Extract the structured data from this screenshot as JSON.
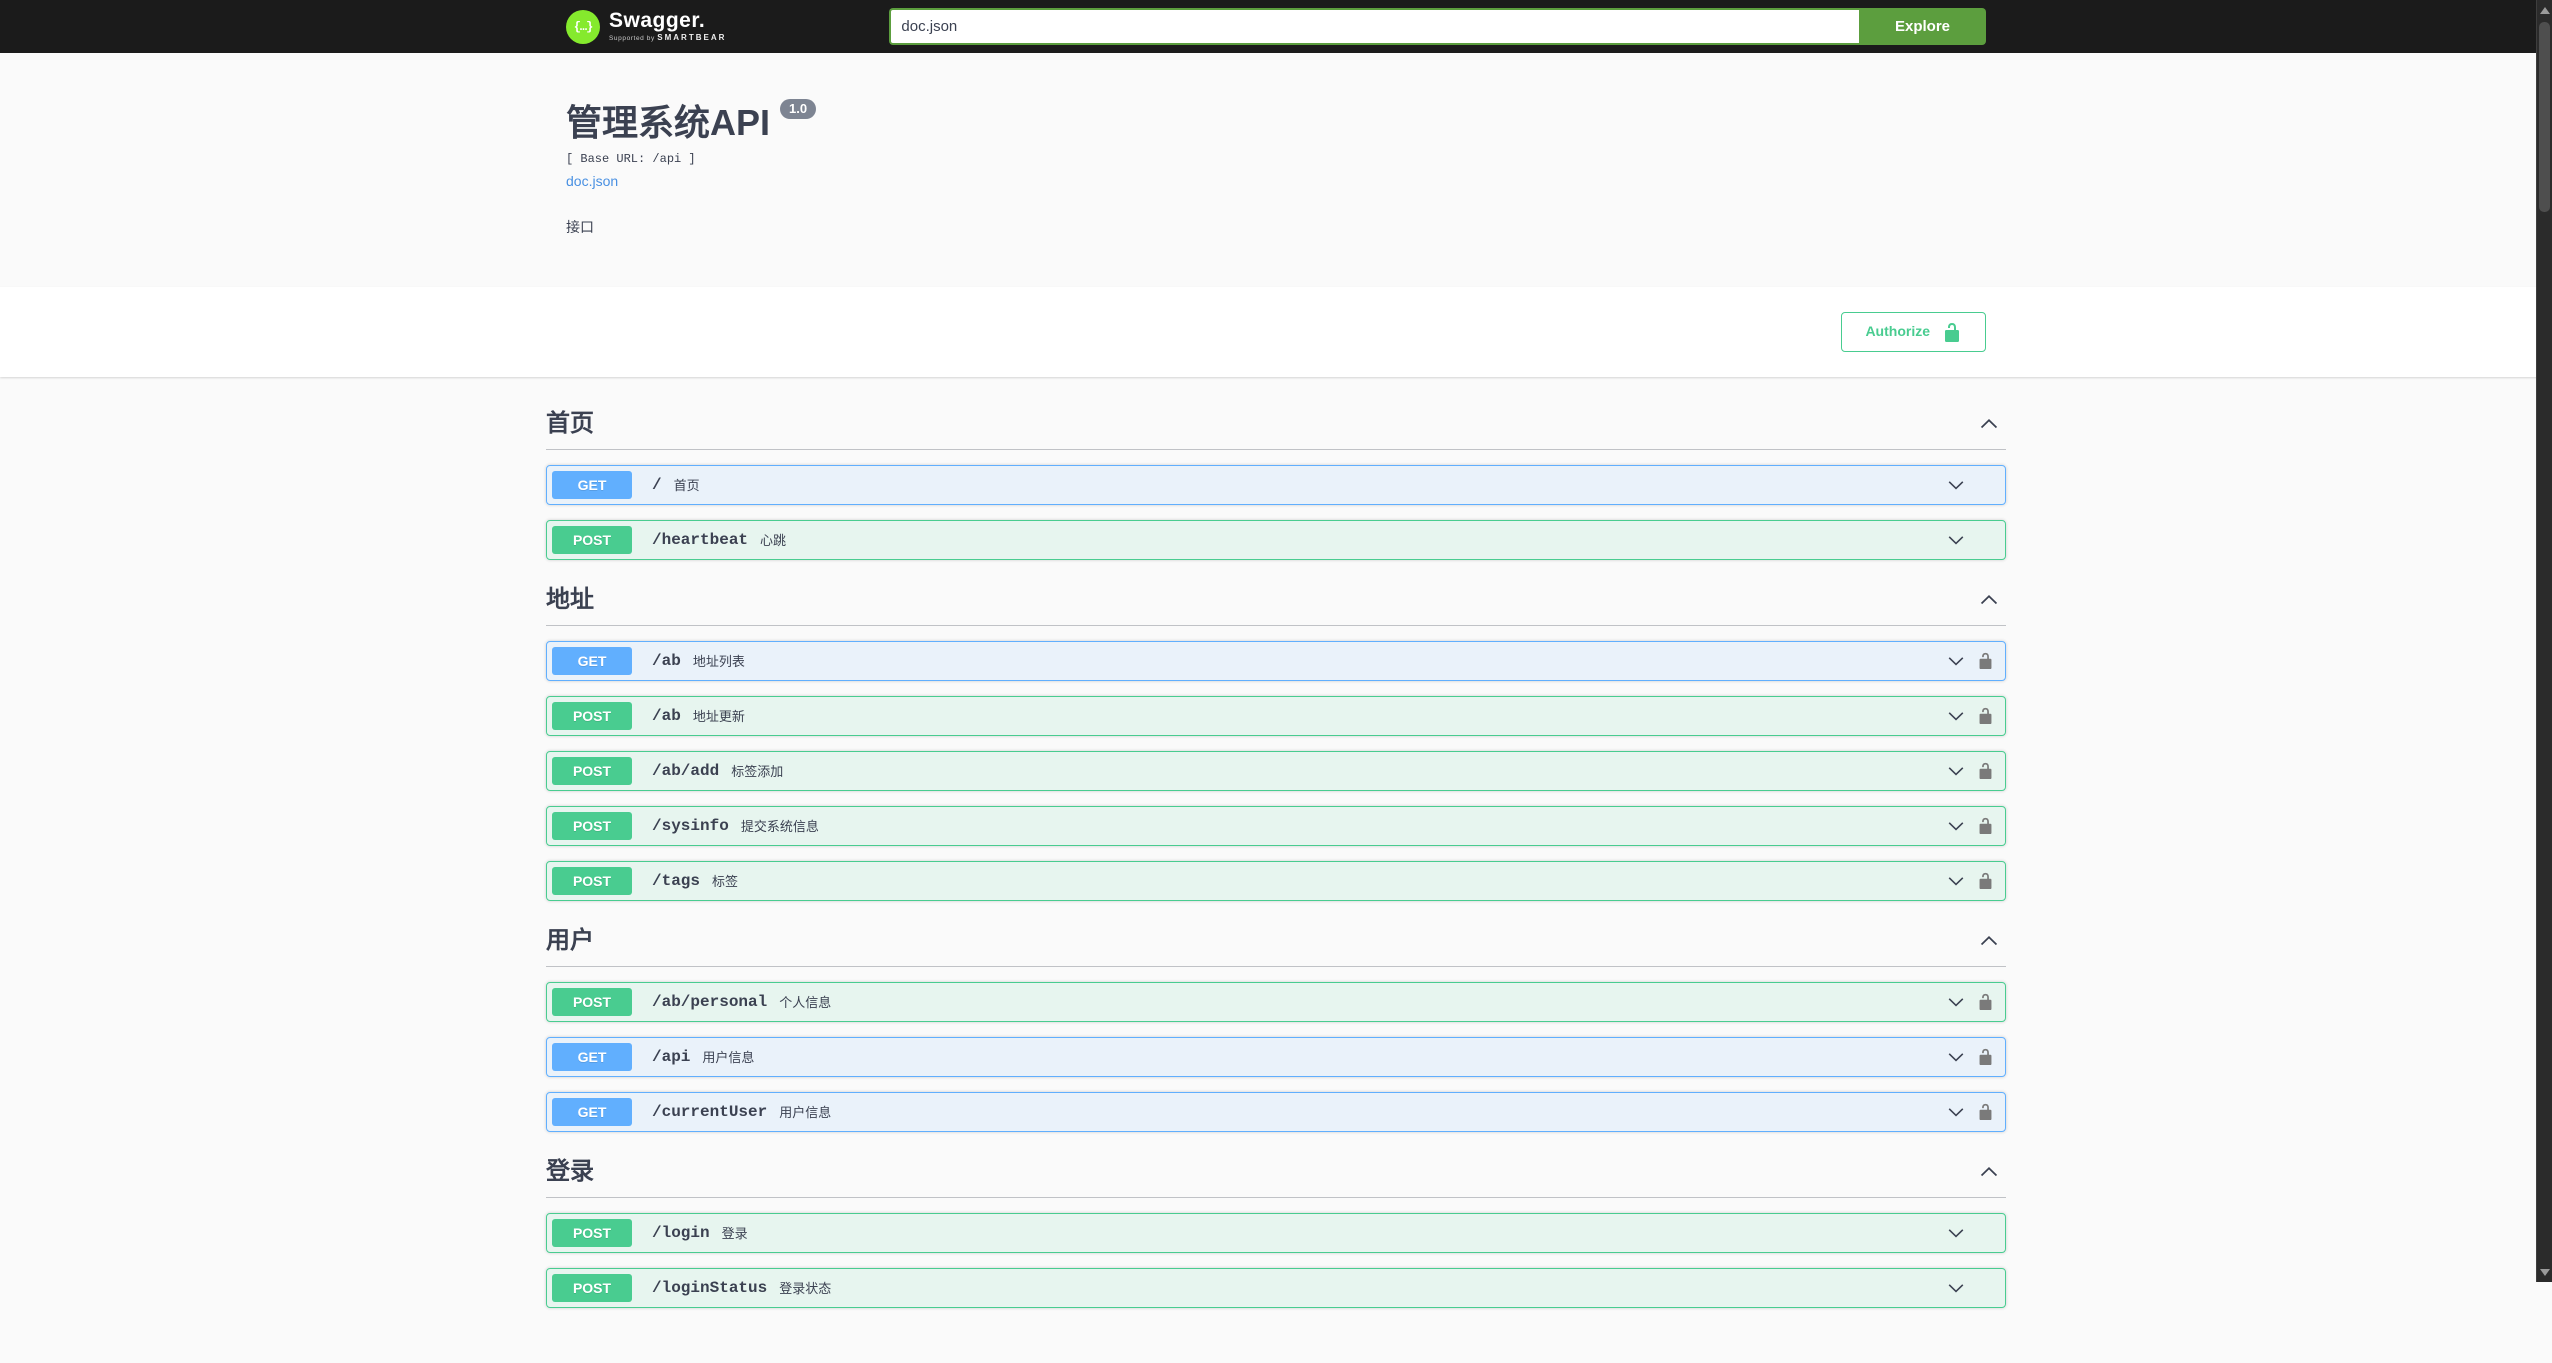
{
  "topbar": {
    "brand": "Swagger",
    "tagline_prefix": "Supported by",
    "tagline_brand": "SMARTBEAR",
    "logo_glyph": "{…}",
    "search_value": "doc.json",
    "explore_label": "Explore"
  },
  "info": {
    "title": "管理系统API",
    "version": "1.0",
    "base_url": "[ Base URL: /api ]",
    "spec_link": "doc.json",
    "description": "接口"
  },
  "auth": {
    "authorize_label": "Authorize"
  },
  "sections": [
    {
      "title": "首页",
      "expanded": true,
      "operations": [
        {
          "method": "GET",
          "path": "/",
          "summary": "首页",
          "locked": false
        },
        {
          "method": "POST",
          "path": "/heartbeat",
          "summary": "心跳",
          "locked": false
        }
      ]
    },
    {
      "title": "地址",
      "expanded": true,
      "operations": [
        {
          "method": "GET",
          "path": "/ab",
          "summary": "地址列表",
          "locked": true
        },
        {
          "method": "POST",
          "path": "/ab",
          "summary": "地址更新",
          "locked": true
        },
        {
          "method": "POST",
          "path": "/ab/add",
          "summary": "标签添加",
          "locked": true
        },
        {
          "method": "POST",
          "path": "/sysinfo",
          "summary": "提交系统信息",
          "locked": true
        },
        {
          "method": "POST",
          "path": "/tags",
          "summary": "标签",
          "locked": true
        }
      ]
    },
    {
      "title": "用户",
      "expanded": true,
      "operations": [
        {
          "method": "POST",
          "path": "/ab/personal",
          "summary": "个人信息",
          "locked": true
        },
        {
          "method": "GET",
          "path": "/api",
          "summary": "用户信息",
          "locked": true
        },
        {
          "method": "GET",
          "path": "/currentUser",
          "summary": "用户信息",
          "locked": true
        }
      ]
    },
    {
      "title": "登录",
      "expanded": true,
      "operations": [
        {
          "method": "POST",
          "path": "/login",
          "summary": "登录",
          "locked": false
        },
        {
          "method": "POST",
          "path": "/loginStatus",
          "summary": "登录状态",
          "locked": false,
          "partial": true
        }
      ]
    }
  ],
  "colors": {
    "get": "#61affe",
    "post": "#49cc90",
    "topbar_bg": "#1b1b1b",
    "explore_green": "#5c9e3e",
    "logo_green": "#85ea2d",
    "link_blue": "#4990e2",
    "version_badge_grey": "#7d8492",
    "text": "#3b4151"
  }
}
